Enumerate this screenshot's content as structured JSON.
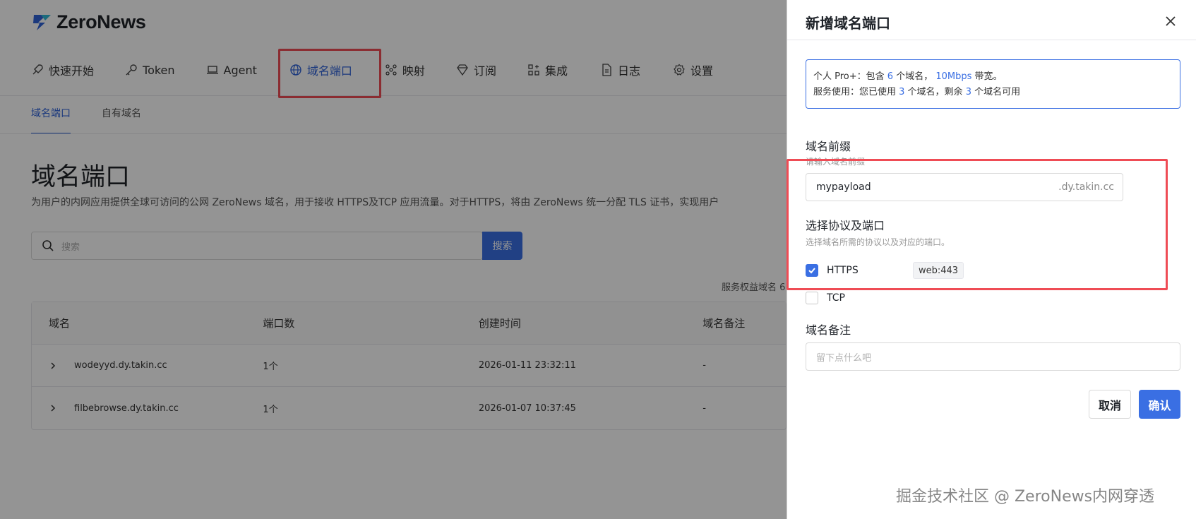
{
  "app": {
    "name": "ZeroNews"
  },
  "colors": {
    "accent": "#3a6fe3",
    "highlight": "#ef4c55"
  },
  "nav": {
    "items": [
      {
        "label": "快速开始",
        "icon": "rocket-icon"
      },
      {
        "label": "Token",
        "icon": "key-icon"
      },
      {
        "label": "Agent",
        "icon": "laptop-icon"
      },
      {
        "label": "域名端口",
        "icon": "globe-icon",
        "active": true
      },
      {
        "label": "映射",
        "icon": "network-icon"
      },
      {
        "label": "订阅",
        "icon": "diamond-icon"
      },
      {
        "label": "集成",
        "icon": "apps-icon"
      },
      {
        "label": "日志",
        "icon": "document-icon"
      },
      {
        "label": "设置",
        "icon": "gear-icon"
      }
    ]
  },
  "subtabs": [
    {
      "label": "域名端口",
      "active": true
    },
    {
      "label": "自有域名"
    }
  ],
  "main": {
    "title": "域名端口",
    "description": "为用户的内网应用提供全球可访问的公网 ZeroNews 域名，用于接收 HTTPS及TCP 应用流量。对于HTTPS，将由 ZeroNews 统一分配 TLS 证书，实现用户",
    "search_placeholder": "搜索",
    "search_button": "搜索",
    "quota_note": "服务权益域名 6"
  },
  "table": {
    "columns": [
      "域名",
      "端口数",
      "创建时间",
      "域名备注"
    ],
    "rows": [
      {
        "domain": "wodeyyd.dy.takin.cc",
        "ports": "1个",
        "created": "2026-01-11 23:32:11",
        "remark": "-"
      },
      {
        "domain": "filbebrowse.dy.takin.cc",
        "ports": "1个",
        "created": "2026-01-07 10:37:45",
        "remark": "-"
      }
    ]
  },
  "drawer": {
    "title": "新增域名端口",
    "plan": {
      "line1_prefix": "个人 Pro+：包含 ",
      "domains_total": "6",
      "line1_mid": " 个域名，",
      "bandwidth": "10Mbps",
      "line1_suffix": " 带宽。",
      "line2_prefix": "服务使用：您已使用 ",
      "domains_used": "3",
      "line2_mid": " 个域名，剩余 ",
      "domains_left": "3",
      "line2_suffix": " 个域名可用"
    },
    "prefix_label": "域名前缀",
    "prefix_hint": "请输入域名前缀",
    "prefix_value": "mypayload",
    "prefix_suffix": ".dy.takin.cc",
    "protocol_label": "选择协议及端口",
    "protocol_hint": "选择域名所需的协议以及对应的端口。",
    "protocols": [
      {
        "label": "HTTPS",
        "checked": true,
        "port": "web:443"
      },
      {
        "label": "TCP",
        "checked": false
      }
    ],
    "remark_label": "域名备注",
    "remark_placeholder": "留下点什么吧",
    "cancel": "取消",
    "confirm": "确认"
  },
  "watermark": "掘金技术社区 @ ZeroNews内网穿透"
}
